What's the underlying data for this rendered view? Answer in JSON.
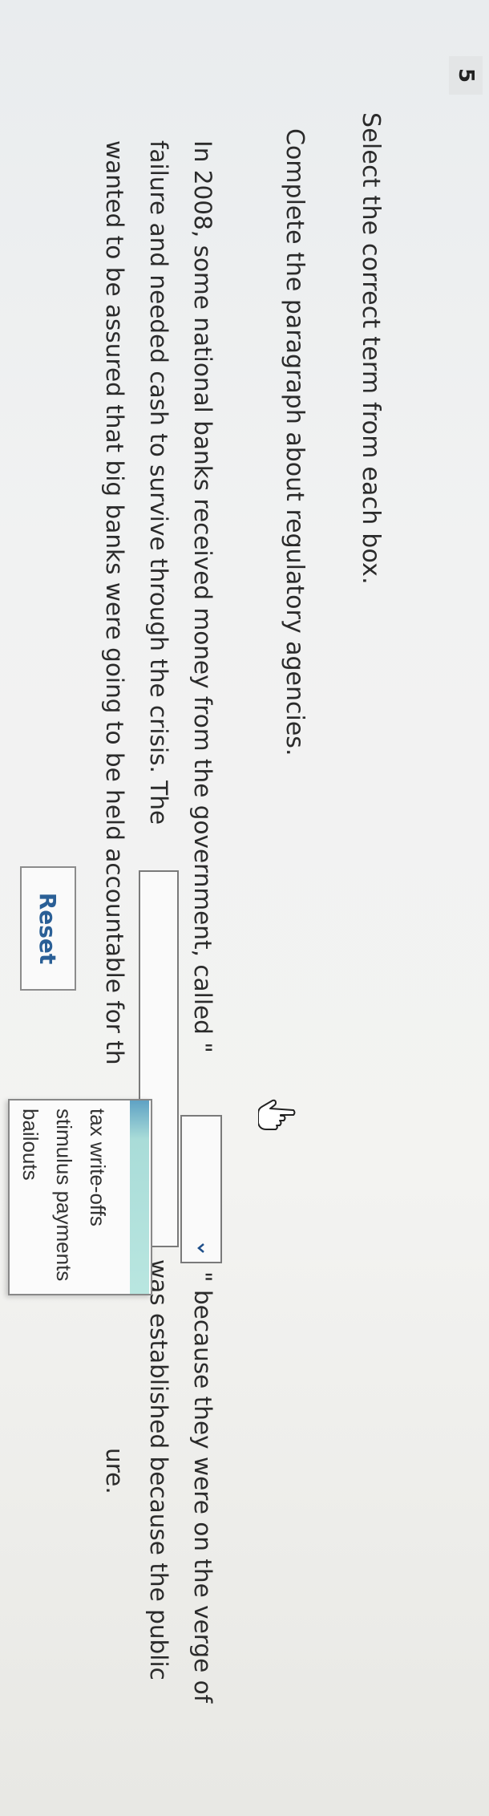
{
  "question": {
    "number": "5",
    "instruction": "Select the correct term from each box.",
    "subtitle": "Complete the paragraph about regulatory agencies."
  },
  "paragraph": {
    "line1_a": "In 2008, some national banks received money from the government, called \"",
    "line1_b": "\" because they were on the verge of",
    "line2_a": "failure and needed cash to survive through the crisis. The",
    "line2_b": "was established because the public",
    "line3_a": "wanted to be assured that big banks were going to be held accountable for th",
    "line3_b": "ure."
  },
  "dropdown_menu": {
    "options": [
      "tax write-offs",
      "stimulus payments",
      "bailouts"
    ],
    "highlighted_index": 0
  },
  "reset_button": {
    "label": "Reset"
  },
  "colors": {
    "reset_text": "#2a5f96",
    "highlight": "#b9e6e0",
    "highlight_edge": "#5fa2c4"
  }
}
